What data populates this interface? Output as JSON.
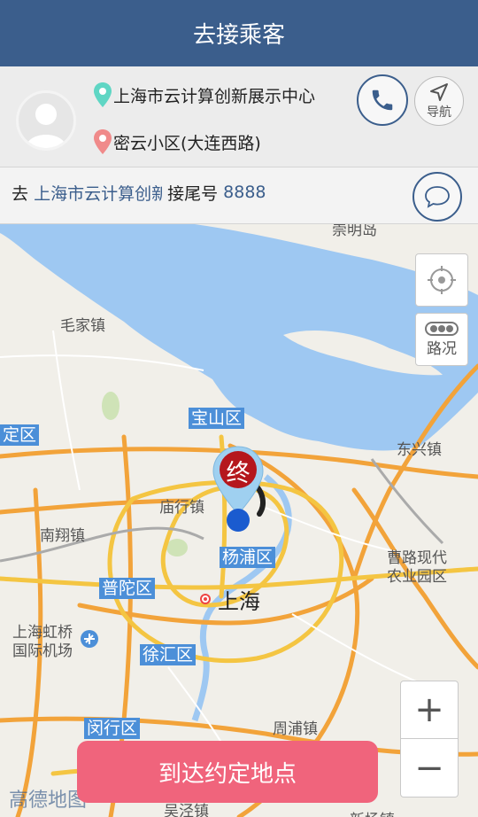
{
  "header": {
    "title": "去接乘客"
  },
  "passenger": {
    "pickup": "上海市云计算创新展示中心",
    "dropoff": "密云小区(大连西路)"
  },
  "actions": {
    "nav_label": "导航"
  },
  "order": {
    "go_prefix": "去",
    "destination": "上海市云计算创新展示中心",
    "tail_label": "接尾号",
    "tail_number": "8888"
  },
  "map": {
    "labels": {
      "chongming": "崇明岛",
      "maojia": "毛家镇",
      "baoshan": "宝山区",
      "jiading": "定区",
      "dongxing": "东兴镇",
      "miaohang": "庙行镇",
      "nanxiang": "南翔镇",
      "yangpu": "杨浦区",
      "caolu": "曹路现代",
      "caolu2": "农业园区",
      "putuo": "普陀区",
      "shanghai": "上海",
      "hongqiao": "上海虹桥",
      "hongqiao2": "国际机场",
      "xuhui": "徐汇区",
      "zhoupu": "周浦镇",
      "minhang": "闵行区",
      "wujing": "吴泾镇",
      "xinchang": "新场镇"
    },
    "marker_label": "终",
    "traffic_label": "路况",
    "logo": "高德地图"
  },
  "controls": {
    "zoom_in": "+",
    "zoom_out": "−"
  },
  "arrive_button": "到达约定地点",
  "colors": {
    "header": "#3b5e8c",
    "arrive": "#f0647c",
    "river": "#9ec8f2",
    "road": "#f4c542"
  }
}
